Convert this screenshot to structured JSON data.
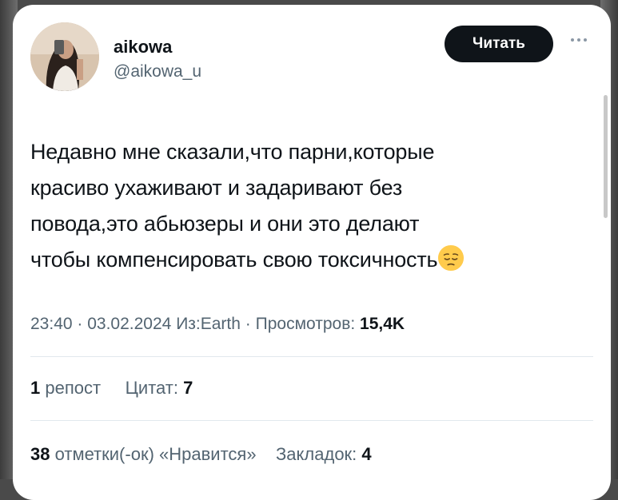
{
  "author": {
    "name": "aikowa",
    "handle": "@aikowa_u",
    "avatar_icon": "profile-photo"
  },
  "actions": {
    "follow_label": "Читать",
    "more_icon": "more-horizontal-icon"
  },
  "tweet": {
    "lines": [
      "Недавно мне сказали,что парни,которые",
      "красиво ухаживают и задаривают без",
      "повода,это абьюзеры и они это делают",
      "чтобы компенсировать свою токсичность"
    ],
    "emoji": "pensive-face-emoji"
  },
  "meta": {
    "time": "23:40",
    "date": "03.02.2024",
    "source_prefix": "Из:",
    "source": "Earth",
    "views_label": "Просмотров:",
    "views_count": "15,4K"
  },
  "stats": {
    "reposts_count": "1",
    "reposts_label": "репост",
    "quotes_label": "Цитат:",
    "quotes_count": "7",
    "likes_count": "38",
    "likes_label": "отметки(-ок) «Нравится»",
    "bookmarks_label": "Закладок:",
    "bookmarks_count": "4"
  },
  "colors": {
    "primary_text": "#0f1419",
    "secondary_text": "#536471",
    "button_bg": "#0f1419",
    "divider": "#e1e8ed"
  }
}
